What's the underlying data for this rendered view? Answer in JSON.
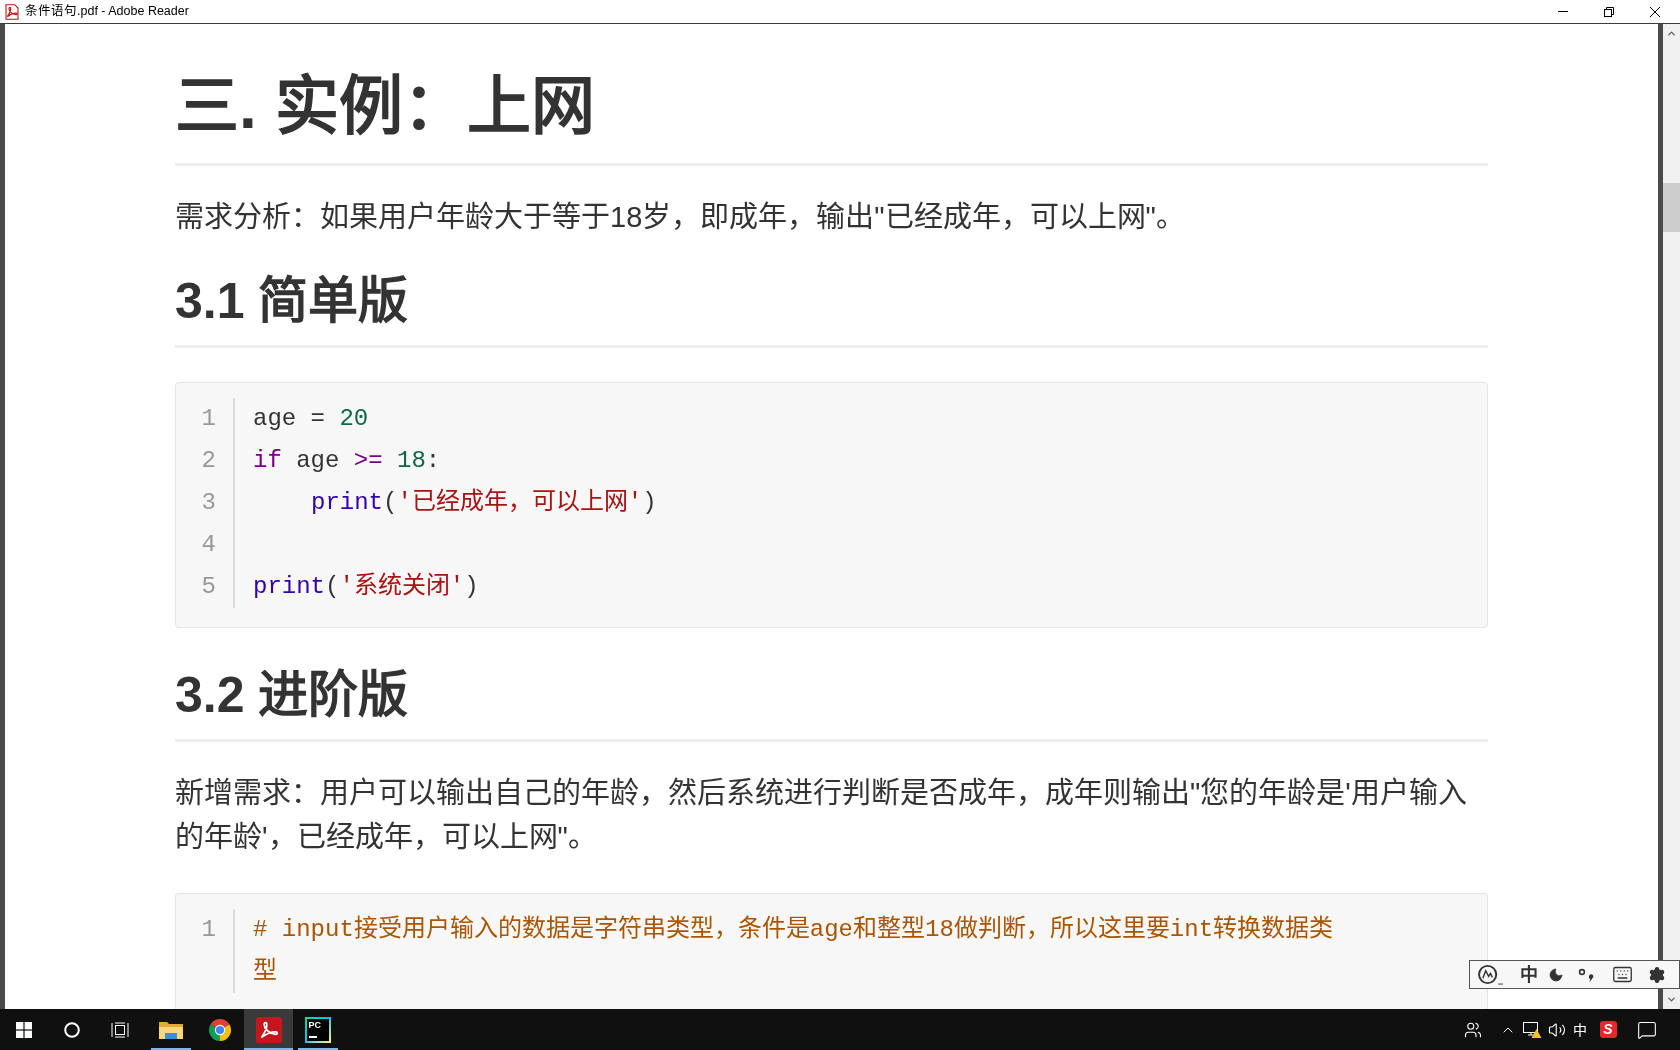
{
  "window": {
    "title": "条件语句.pdf - Adobe Reader"
  },
  "document": {
    "blocks": [
      {
        "kind": "heading1",
        "text": "三. 实例：上网"
      },
      {
        "kind": "paragraph",
        "text": "需求分析：如果用户年龄大于等于18岁，即成年，输出\"已经成年，可以上网\"。"
      },
      {
        "kind": "heading2",
        "text": "3.1 简单版"
      },
      {
        "kind": "code",
        "lines": [
          {
            "number": "1",
            "tokens": [
              {
                "kind": "plain",
                "text": "age = "
              },
              {
                "kind": "number",
                "text": "20"
              }
            ]
          },
          {
            "number": "2",
            "tokens": [
              {
                "kind": "keyword",
                "text": "if"
              },
              {
                "kind": "plain",
                "text": " age "
              },
              {
                "kind": "operator",
                "text": ">="
              },
              {
                "kind": "number",
                "text": " 18"
              },
              {
                "kind": "plain",
                "text": ":"
              }
            ],
            "children": [
              {
                "number": "3",
                "tokens": [
                  {
                    "kind": "builtin",
                    "text": "print"
                  },
                  {
                    "kind": "plain",
                    "text": "("
                  },
                  {
                    "kind": "string",
                    "text": "'已经成年，可以上网'"
                  },
                  {
                    "kind": "plain",
                    "text": ")"
                  }
                ]
              }
            ]
          },
          {
            "number": "4"
          },
          {
            "number": "5",
            "tokens": [
              {
                "kind": "builtin",
                "text": "print"
              },
              {
                "kind": "plain",
                "text": "("
              },
              {
                "kind": "string",
                "text": "'系统关闭'"
              },
              {
                "kind": "plain",
                "text": ")"
              }
            ]
          }
        ]
      },
      {
        "kind": "heading2",
        "text": "3.2 进阶版"
      },
      {
        "kind": "paragraph",
        "text": "新增需求：用户可以输出自己的年龄，然后系统进行判断是否成年，成年则输出\"您的年龄是'用户输入的年龄'，已经成年，可以上网\"。"
      },
      {
        "kind": "code",
        "lines": [
          {
            "number": "1",
            "tokens": [
              {
                "kind": "comment",
                "text": "# input接受用户输入的数据是字符串类型，条件是age和整型18做判断，所以这里要int转换数据类型"
              }
            ]
          }
        ]
      }
    ]
  },
  "ime_toolbar": {
    "input_mode": "中"
  },
  "taskbar": {
    "apps": [
      {
        "kind": "folder",
        "running": true,
        "selected": false
      },
      {
        "kind": "browser",
        "running": false,
        "selected": false
      },
      {
        "kind": "pdf-reader",
        "running": true,
        "selected": true
      },
      {
        "kind": "ide",
        "logo": "PC",
        "running": true,
        "selected": false
      }
    ],
    "tray": {
      "input_mode": "中",
      "ime_badge": "S"
    }
  }
}
